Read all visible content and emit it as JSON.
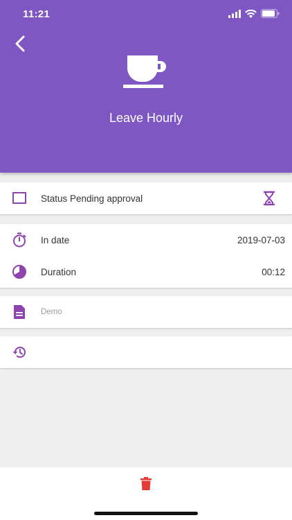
{
  "status_bar": {
    "time": "11:21"
  },
  "header": {
    "title": "Leave Hourly",
    "bg_color": "#7e57c2"
  },
  "status_card": {
    "label": "Status Pending approval",
    "icons": {
      "left": "checkbox-outline-icon",
      "right": "hourglass-icon"
    }
  },
  "details_card": {
    "rows": [
      {
        "icon": "stopwatch-icon",
        "label": "In date",
        "value": "2019-07-03"
      },
      {
        "icon": "pie-chart-icon",
        "label": "Duration",
        "value": "00:12"
      }
    ]
  },
  "note_card": {
    "icon": "document-icon",
    "text": "Demo"
  },
  "history_card": {
    "icon": "history-icon"
  },
  "bottom_bar": {
    "delete_icon": "trash-icon",
    "delete_color": "#e53935"
  },
  "accent_color": "#8e44ad"
}
